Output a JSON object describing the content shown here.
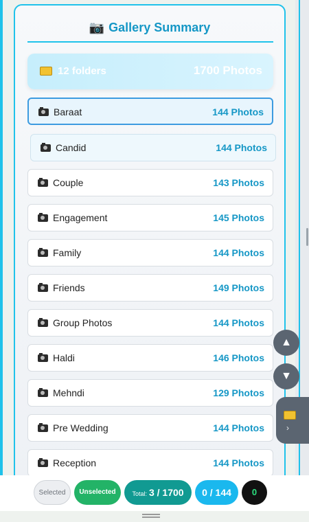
{
  "title": {
    "icon": "camera-icon",
    "text": "Gallery Summary"
  },
  "summary": {
    "folders": "12 folders",
    "photos": "1700 Photos"
  },
  "folders": [
    {
      "name": "Baraat",
      "count": "144 Photos"
    },
    {
      "name": "Candid",
      "count": "144 Photos"
    },
    {
      "name": "Couple",
      "count": "143 Photos"
    },
    {
      "name": "Engagement",
      "count": "145 Photos"
    },
    {
      "name": "Family",
      "count": "144 Photos"
    },
    {
      "name": "Friends",
      "count": "149 Photos"
    },
    {
      "name": "Group Photos",
      "count": "144 Photos"
    },
    {
      "name": "Haldi",
      "count": "146 Photos"
    },
    {
      "name": "Mehndi",
      "count": "129 Photos"
    },
    {
      "name": "Pre Wedding",
      "count": "144 Photos"
    },
    {
      "name": "Reception",
      "count": "144 Photos"
    }
  ],
  "nav": {
    "up": "▲",
    "down": "▼",
    "chevron": "›"
  },
  "bottom": {
    "selected": "Selected",
    "unselected": "Unselected",
    "total_label": "Total:",
    "total_value": "3 / 1700",
    "sub_value": "0 / 144",
    "zero_value": "0"
  },
  "colors": {
    "accent": "#1fc2ea",
    "count_text": "#1597c6",
    "unselected": "#23b367",
    "total": "#119a92"
  }
}
